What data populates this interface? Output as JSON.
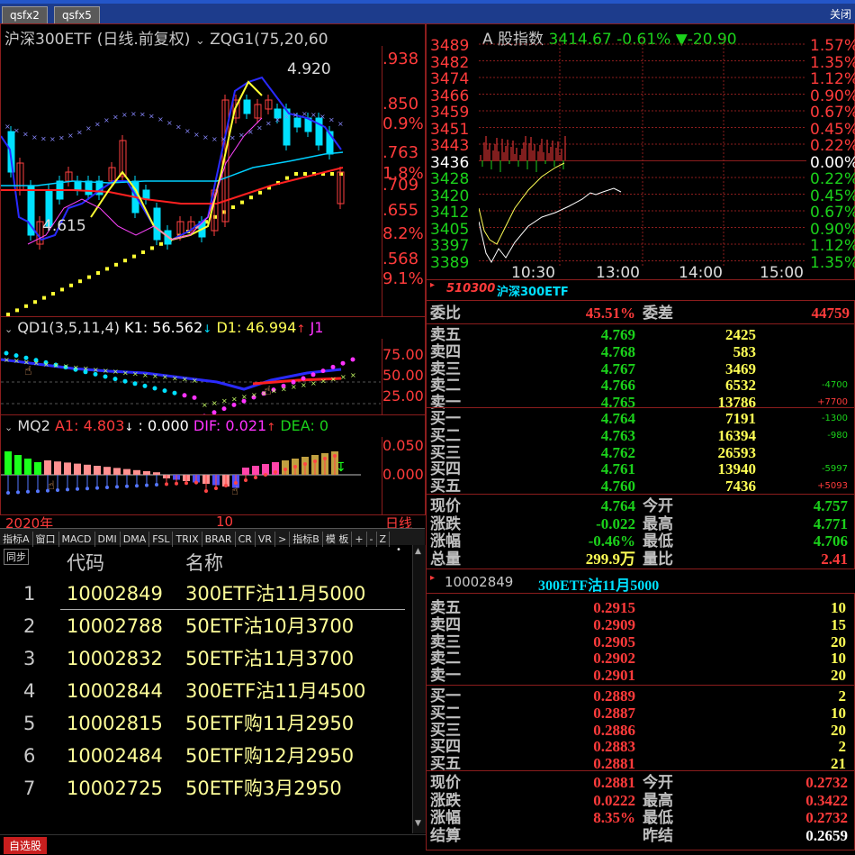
{
  "tabs": [
    "qsfx2",
    "qsfx5"
  ],
  "close_label": "关闭",
  "main_chart": {
    "title": "沪深300ETF (日线.前复权)",
    "indicator": "ZQG1(75,20,60",
    "high_label": "4.920",
    "low_label": "4.615",
    "right_axis": [
      ".938",
      ".850",
      "0.9%",
      ".763",
      "1.8%",
      ".709",
      ".655",
      "8.2%",
      ".568",
      "9.1%"
    ]
  },
  "qd1": {
    "name": "QD1(3,5,11,4)",
    "k1_label": "K1: 56.562",
    "d1_label": "D1: 46.994",
    "j1_label": "J1",
    "axis": [
      "75.00",
      "50.00",
      "25.00"
    ]
  },
  "mq2": {
    "name": "MQ2",
    "a1_label": "A1: 4.803",
    "zero_label": ": 0.000",
    "dif_label": "DIF: 0.021",
    "dea_label": "DEA: 0",
    "axis": [
      "0.050",
      "0.000"
    ]
  },
  "date_axis": {
    "left": "2020年",
    "mid": "10",
    "right": "日线"
  },
  "chart_tabs": [
    "指标A",
    "窗口",
    "MACD",
    "DMI",
    "DMA",
    "FSL",
    "TRIX",
    "BRAR",
    "CR",
    "VR",
    ">",
    "指标B",
    "模 板",
    "+",
    "-",
    "Z"
  ],
  "list_header": {
    "sync": "同步",
    "code": "代码",
    "name": "名称"
  },
  "list_rows": [
    {
      "num": "1",
      "code": "10002849",
      "name": "300ETF沽11月5000"
    },
    {
      "num": "2",
      "code": "10002788",
      "name": "50ETF沽10月3700"
    },
    {
      "num": "3",
      "code": "10002832",
      "name": "50ETF沽11月3700"
    },
    {
      "num": "4",
      "code": "10002844",
      "name": "300ETF沽11月4500"
    },
    {
      "num": "5",
      "code": "10002815",
      "name": "50ETF购11月2950"
    },
    {
      "num": "6",
      "code": "10002484",
      "name": "50ETF购12月2950"
    },
    {
      "num": "7",
      "code": "10002725",
      "name": "50ETF购3月2950"
    }
  ],
  "bottom_tab": "自选股",
  "index_chart": {
    "title": "A 股指数",
    "value": "3414.67",
    "change_pct": "-0.61%",
    "change": "▼-20.90",
    "left_axis": [
      "3489",
      "3482",
      "3474",
      "3466",
      "3459",
      "3451",
      "3443",
      "3436",
      "3428",
      "3420",
      "3412",
      "3405",
      "3397",
      "3389"
    ],
    "right_axis": [
      "1.57%",
      "1.35%",
      "1.12%",
      "0.90%",
      "0.67%",
      "0.45%",
      "0.22%",
      "0.00%",
      "0.22%",
      "0.45%",
      "0.67%",
      "0.90%",
      "1.12%",
      "1.35%"
    ],
    "times": [
      "10:30",
      "13:00",
      "14:00",
      "15:00"
    ]
  },
  "etf_quote": {
    "code": "510300",
    "name": "沪深300ETF",
    "weibi_label": "委比",
    "weibi": "45.51%",
    "weicha_label": "委差",
    "weicha": "44759",
    "sells": [
      {
        "label": "卖五",
        "price": "4.769",
        "vol": "2425",
        "chg": ""
      },
      {
        "label": "卖四",
        "price": "4.768",
        "vol": "583",
        "chg": ""
      },
      {
        "label": "卖三",
        "price": "4.767",
        "vol": "3469",
        "chg": ""
      },
      {
        "label": "卖二",
        "price": "4.766",
        "vol": "6532",
        "chg": "-4700"
      },
      {
        "label": "卖一",
        "price": "4.765",
        "vol": "13786",
        "chg": "+7700"
      }
    ],
    "buys": [
      {
        "label": "买一",
        "price": "4.764",
        "vol": "7191",
        "chg": "-1300"
      },
      {
        "label": "买二",
        "price": "4.763",
        "vol": "16394",
        "chg": "-980"
      },
      {
        "label": "买三",
        "price": "4.762",
        "vol": "26593",
        "chg": ""
      },
      {
        "label": "买四",
        "price": "4.761",
        "vol": "13940",
        "chg": "-5997"
      },
      {
        "label": "买五",
        "price": "4.760",
        "vol": "7436",
        "chg": "+5093"
      }
    ],
    "stats": [
      {
        "l1": "现价",
        "v1": "4.764",
        "l2": "今开",
        "v2": "4.757"
      },
      {
        "l1": "涨跌",
        "v1": "-0.022",
        "l2": "最高",
        "v2": "4.771"
      },
      {
        "l1": "涨幅",
        "v1": "-0.46%",
        "l2": "最低",
        "v2": "4.706"
      },
      {
        "l1": "总量",
        "v1": "299.9万",
        "l2": "量比",
        "v2": "2.41"
      }
    ]
  },
  "option_quote": {
    "code": "10002849",
    "name": "300ETF沽11月5000",
    "sells": [
      {
        "label": "卖五",
        "price": "0.2915",
        "vol": "10"
      },
      {
        "label": "卖四",
        "price": "0.2909",
        "vol": "15"
      },
      {
        "label": "卖三",
        "price": "0.2905",
        "vol": "20"
      },
      {
        "label": "卖二",
        "price": "0.2902",
        "vol": "10"
      },
      {
        "label": "卖一",
        "price": "0.2901",
        "vol": "20"
      }
    ],
    "buys": [
      {
        "label": "买一",
        "price": "0.2889",
        "vol": "2"
      },
      {
        "label": "买二",
        "price": "0.2887",
        "vol": "10"
      },
      {
        "label": "买三",
        "price": "0.2886",
        "vol": "20"
      },
      {
        "label": "买四",
        "price": "0.2883",
        "vol": "2"
      },
      {
        "label": "买五",
        "price": "0.2881",
        "vol": "21"
      }
    ],
    "stats": [
      {
        "l1": "现价",
        "v1": "0.2881",
        "l2": "今开",
        "v2": "0.2732"
      },
      {
        "l1": "涨跌",
        "v1": "0.0222",
        "l2": "最高",
        "v2": "0.3422"
      },
      {
        "l1": "涨幅",
        "v1": "8.35%",
        "l2": "最低",
        "v2": "0.2732"
      },
      {
        "l1": "结算",
        "v1": "",
        "l2": "昨结",
        "v2": "0.2659"
      }
    ]
  },
  "colors": {
    "up": "#ff3b3b",
    "down": "#1bd11b",
    "frame": "#8b1d1d",
    "title_bar": "#1d3c8c"
  }
}
